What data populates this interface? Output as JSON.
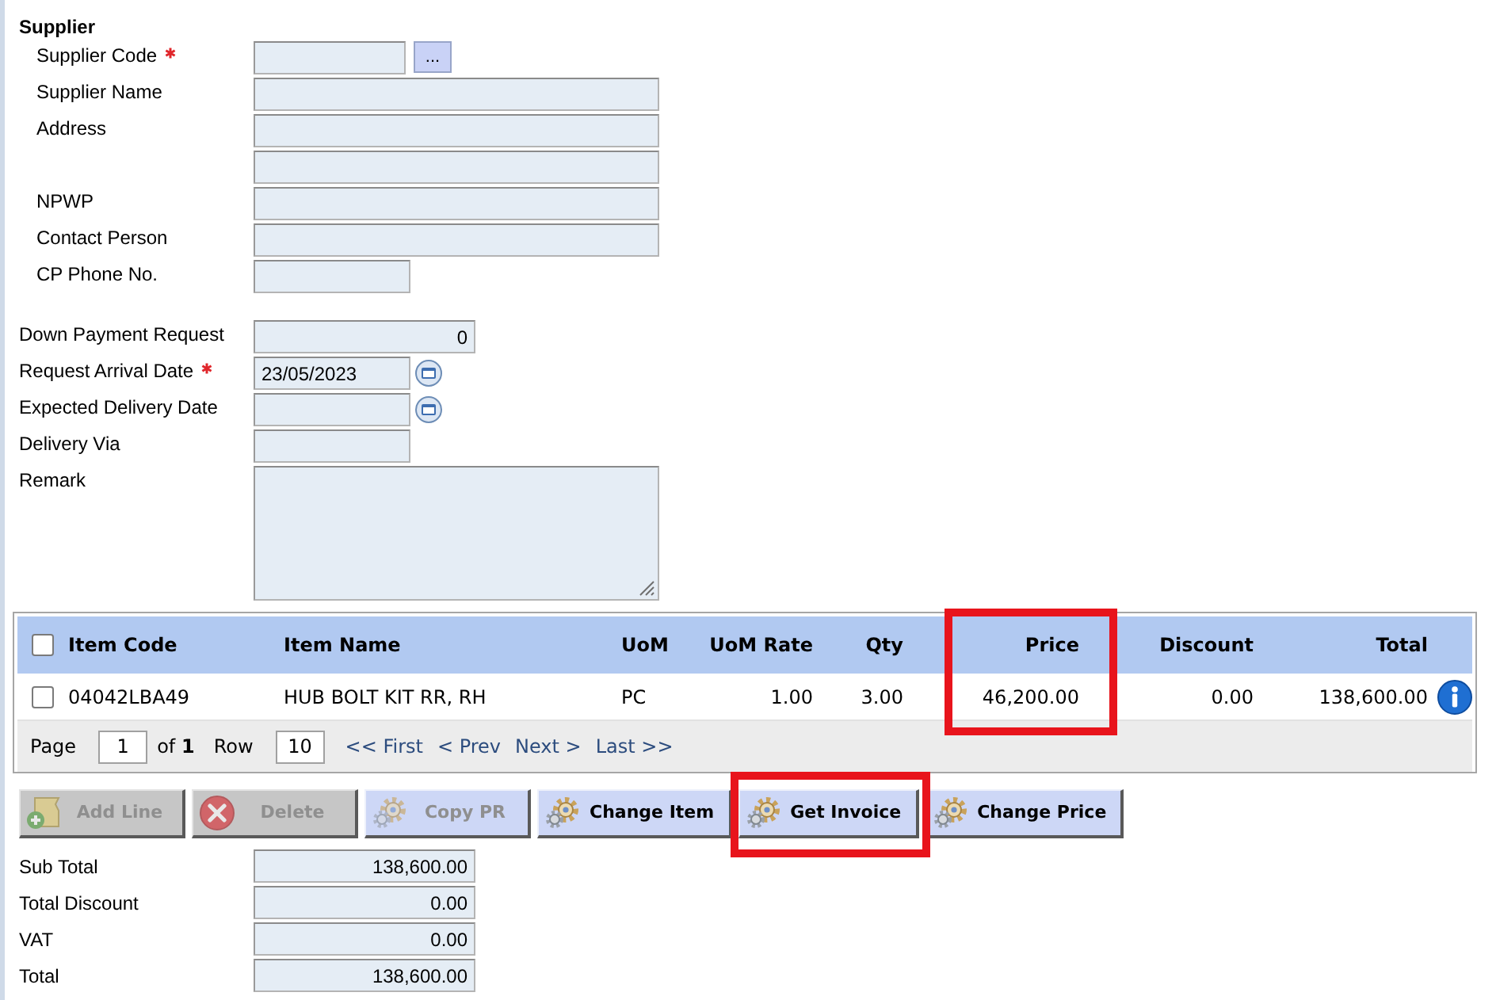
{
  "supplier": {
    "heading": "Supplier",
    "fields": [
      {
        "label": "Supplier Code",
        "required": true,
        "kind": "lookup",
        "button": "..."
      },
      {
        "label": "Supplier Name",
        "required": false,
        "kind": "wide"
      },
      {
        "label": "Address",
        "required": false,
        "kind": "wide"
      },
      {
        "required": false,
        "kind": "wide"
      },
      {
        "label": "NPWP",
        "required": false,
        "kind": "wide"
      },
      {
        "label": "Contact Person",
        "required": false,
        "kind": "wide"
      },
      {
        "label": "CP Phone No.",
        "required": false,
        "kind": "short"
      }
    ]
  },
  "details": {
    "fields": [
      {
        "label": "Down Payment Request",
        "required": false,
        "kind": "amount",
        "value": "0"
      },
      {
        "label": "Request Arrival Date",
        "required": true,
        "kind": "date",
        "value": "23/05/2023"
      },
      {
        "label": "Expected Delivery Date",
        "required": false,
        "kind": "date"
      },
      {
        "label": "Delivery Via",
        "required": false,
        "kind": "short"
      },
      {
        "label": "Remark",
        "required": false,
        "kind": "memo"
      }
    ]
  },
  "items_table": {
    "all_checked": false,
    "columns": [
      {
        "label": "Item Code",
        "kind": "text",
        "highlighted": false
      },
      {
        "label": "Item Name",
        "kind": "text",
        "highlighted": false
      },
      {
        "label": "UoM",
        "kind": "text",
        "highlighted": false
      },
      {
        "label": "UoM Rate",
        "kind": "number",
        "highlighted": false
      },
      {
        "label": "Qty",
        "kind": "number",
        "highlighted": false
      },
      {
        "label": "Price",
        "kind": "number",
        "highlighted": true
      },
      {
        "label": "Discount",
        "kind": "number",
        "highlighted": false
      },
      {
        "label": "Total",
        "kind": "number",
        "highlighted": false
      }
    ],
    "rows": [
      {
        "checked": false,
        "cells": [
          "04042LBA49",
          "HUB BOLT KIT RR, RH",
          "PC",
          "1.00",
          "3.00",
          "46,200.00",
          "0.00",
          "138,600.00"
        ]
      }
    ],
    "pager": {
      "page_label": "Page",
      "page": "1",
      "page_count": "of **1**",
      "row_label": "Row",
      "rows_per_page": "10",
      "links": [
        "<< First",
        "< Prev",
        "Next >",
        "Last >>"
      ]
    }
  },
  "buttons": [
    {
      "label": "Add Line",
      "kind": "add",
      "disabled": true,
      "highlighted": false
    },
    {
      "label": "Delete",
      "kind": "delete",
      "disabled": true,
      "highlighted": false
    },
    {
      "label": "Copy PR",
      "kind": "process",
      "disabled": true,
      "highlighted": false
    },
    {
      "label": "Change Item",
      "kind": "process",
      "disabled": false,
      "highlighted": false
    },
    {
      "label": "Get Invoice",
      "kind": "process",
      "disabled": false,
      "highlighted": true
    },
    {
      "label": "Change Price",
      "kind": "process",
      "disabled": false,
      "highlighted": false
    }
  ],
  "totals": [
    {
      "label": "Sub Total",
      "value": "138,600.00"
    },
    {
      "label": "Total Discount",
      "value": "0.00"
    },
    {
      "label": "VAT",
      "value": "0.00"
    },
    {
      "label": "Total",
      "value": "138,600.00"
    }
  ]
}
